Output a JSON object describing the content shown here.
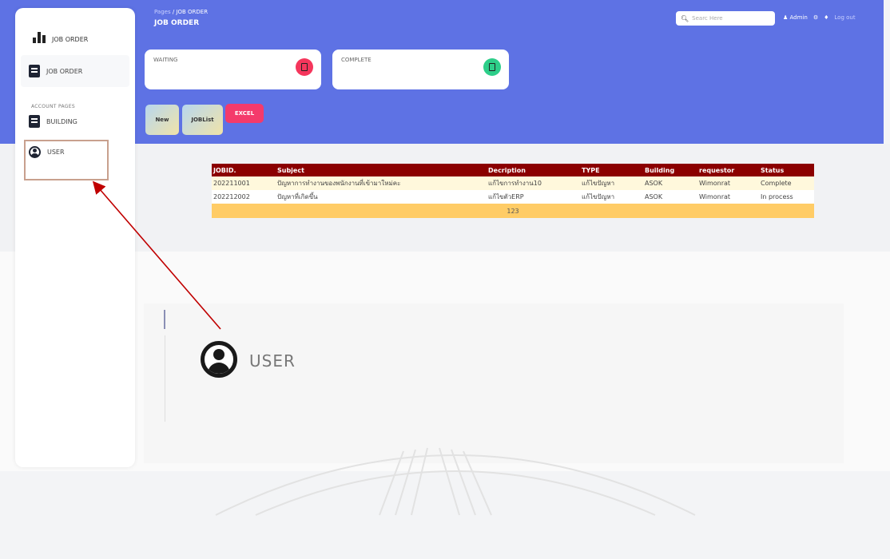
{
  "sidebar": {
    "brand": "JOB ORDER",
    "items": [
      {
        "label": "JOB ORDER",
        "icon": "clipboard-icon"
      },
      {
        "label": "BUILDING",
        "icon": "building-icon"
      },
      {
        "label": "USER",
        "icon": "user-circle-icon"
      }
    ],
    "section_label": "ACCOUNT PAGES"
  },
  "header": {
    "breadcrumb_root": "Pages",
    "breadcrumb_sep": "/",
    "breadcrumb_current": "JOB ORDER",
    "title": "JOB ORDER",
    "search_placeholder": "Searc Here",
    "admin_label": "Admin",
    "logout_label": "Log out"
  },
  "cards": [
    {
      "label": "WAITING",
      "icon_color": "#f5365c"
    },
    {
      "label": "COMPLETE",
      "icon_color": "#2dce89"
    }
  ],
  "buttons": {
    "new": "New",
    "joblist": "JOBList",
    "excel": "EXCEL"
  },
  "table": {
    "columns": [
      "JOBID.",
      "Subject",
      "Decription",
      "TYPE",
      "Building",
      "requestor",
      "Status"
    ],
    "rows": [
      [
        "202211001",
        "ปัญหาการทำงานของพนักงานที่เข้ามาใหม่คะ",
        "แก้ไขการทำงาน10",
        "แก้ไขปัญหา",
        "ASOK",
        "Wimonrat",
        "Complete"
      ],
      [
        "202212002",
        "ปัญหาที่เกิดขึ้น",
        "แก้ไขตัวERP",
        "แก้ไขปัญหา",
        "ASOK",
        "Wimonrat",
        "In process"
      ]
    ],
    "footer": "123"
  },
  "zoom_callout": {
    "label": "USER",
    "icon": "user-circle-icon"
  },
  "colors": {
    "header_bg": "#5e72e4",
    "table_header_bg": "#8b0000",
    "table_footer_bg": "#ffcc66",
    "annotation_arrow": "#c00000"
  }
}
